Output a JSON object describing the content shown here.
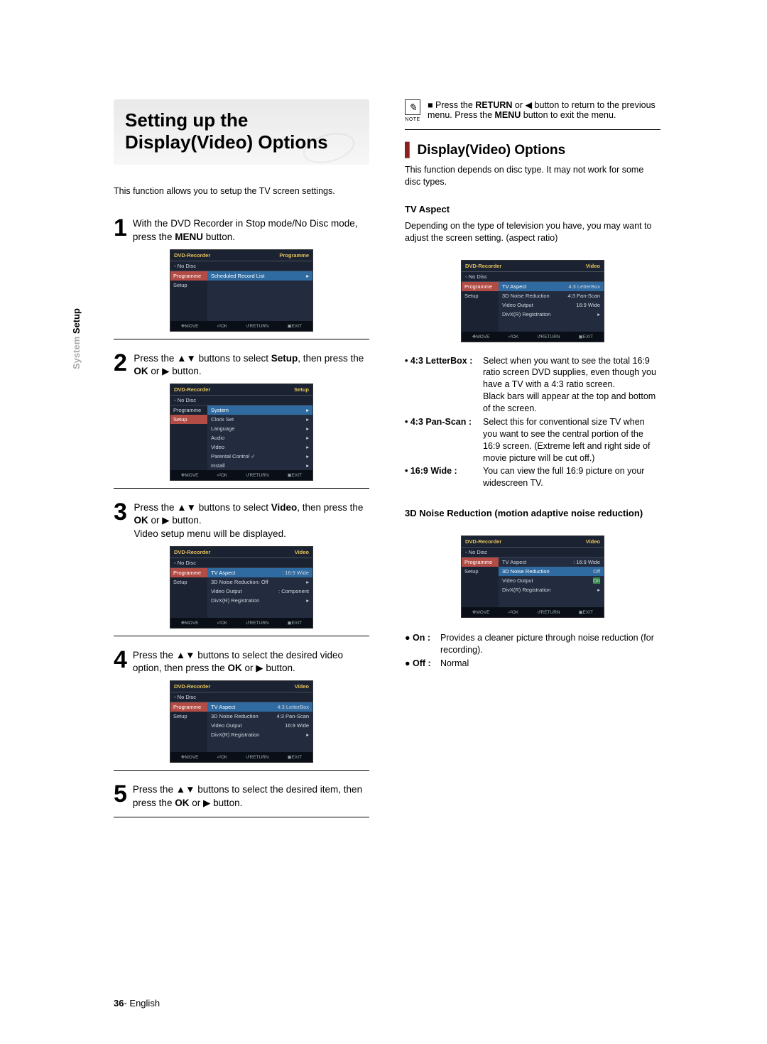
{
  "sideTab": {
    "gray": "System ",
    "strong": "Setup"
  },
  "banner": "Setting up the Display(Video) Options",
  "introLeft": "This function allows you to setup the TV screen settings.",
  "steps": {
    "s1": "With the DVD Recorder in Stop mode/No Disc mode, press the MENU button.",
    "s2": "Press the ▲▼ buttons to select Setup, then press the OK or ▶ button.",
    "s3a": "Press the ▲▼ buttons to select Video, then press the OK or ▶ button.",
    "s3b": "Video setup menu will be displayed.",
    "s4": "Press the ▲▼ buttons to select the desired video option, then press the OK or ▶ button.",
    "s5": "Press the ▲▼ buttons to select the desired item, then press the OK or ▶ button."
  },
  "menu": {
    "title": "DVD-Recorder",
    "modeProg": "Programme",
    "modeSetup": "Setup",
    "modeVideo": "Video",
    "noDisc": "No Disc",
    "sideProg": "Programme",
    "sideSetup": "Setup",
    "scheduled": "Scheduled Record List",
    "footer_move": "MOVE",
    "footer_ok": "OK",
    "footer_return": "RETURN",
    "footer_exit": "EXIT",
    "system": "System",
    "clockset": "Clock Set",
    "language": "Language",
    "audio": "Audio",
    "video": "Video",
    "parental": "Parental Control ✓",
    "install": "Install",
    "tvaspect": "TV Aspect",
    "tvaspect_v": ": 16:9 Wide",
    "noise": "3D Noise Reduction",
    "noise_off": ": Off",
    "vout": "Video Output",
    "vout_v": ": Component",
    "divx": "DivX(R) Registration",
    "lb": "4:3 LetterBox",
    "ps": "4:3 Pan-Scan",
    "wd": "16:9 Wide",
    "noise_offv": "Off",
    "noise_onv": "On"
  },
  "noteLabel": "NOTE",
  "noteText": "Press the RETURN or ◀ button to return to the previous menu. Press the MENU button to exit the menu.",
  "h2": "Display(Video) Options",
  "rightIntro": "This function depends on disc type. It may not work for some disc types.",
  "tvAspectHead": "TV Aspect",
  "tvAspectDesc": "Depending on the type of television you have, you may want to adjust the screen setting. (aspect ratio)",
  "defs": {
    "lb_t": "• 4:3 LetterBox :",
    "lb_d1": "Select when you want to see the total 16:9 ratio screen DVD supplies, even though you have a TV with a 4:3 ratio screen.",
    "lb_d2": "Black bars will appear at the top and bottom of the screen.",
    "ps_t": "• 4:3 Pan-Scan :",
    "ps_d": "Select this for conventional size TV when you want to see the central portion of the 16:9 screen. (Extreme left and right side of movie picture will be cut off.)",
    "wd_t": "• 16:9 Wide  :",
    "wd_d": "You can view the full 16:9 picture on your widescreen TV."
  },
  "noiseHead": "3D Noise Reduction (motion adaptive noise reduction)",
  "noiseBullets": {
    "on_t": "● On :",
    "on_d": "Provides a cleaner picture through noise reduction (for recording).",
    "off_t": "● Off :",
    "off_d": "Normal"
  },
  "footerPage": "36",
  "footerLang": "- English"
}
